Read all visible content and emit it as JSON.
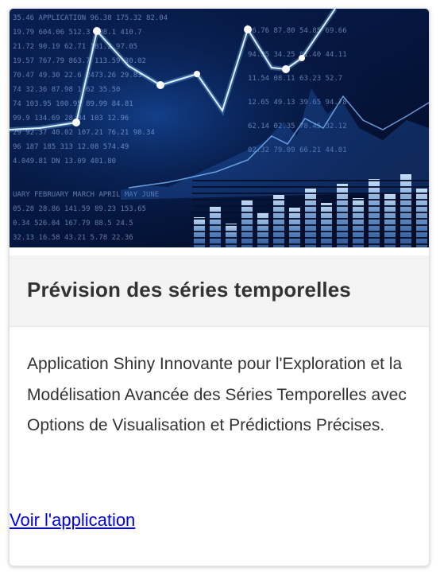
{
  "card": {
    "image_icon": "financial-market-chart-image",
    "title": "Prévision des séries temporelles",
    "description": "Application Shiny Innovante pour l'Exploration et la Modélisation Avancée des Séries Temporelles avec Options de Visualisation et Prédictions Précises.",
    "link_label": "Voir l'application"
  },
  "colors": {
    "header_bg": "#f3f3f3",
    "text": "#333333",
    "link": "#0000ee",
    "image_bg": "#04102e",
    "chart_glow": "#6fb6ff"
  }
}
